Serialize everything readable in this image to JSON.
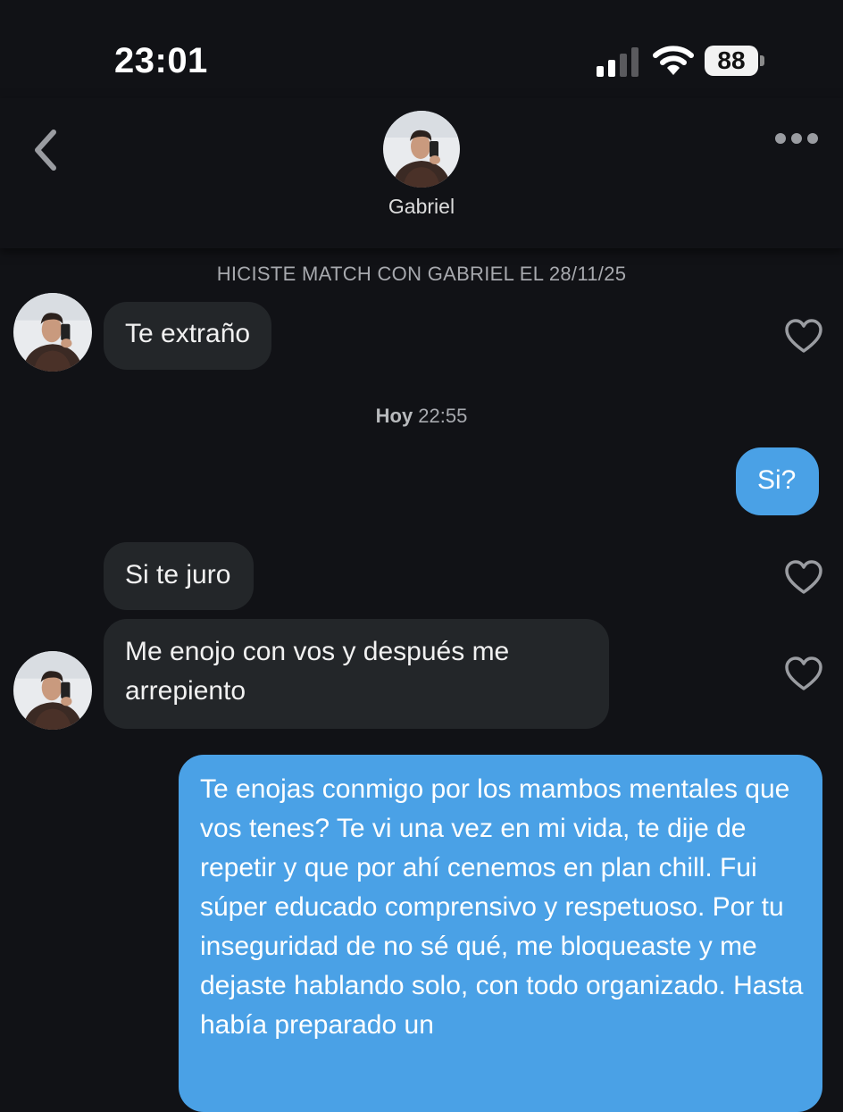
{
  "status_bar": {
    "time": "23:01",
    "battery_level": "88",
    "signal_icon": "cell-signal-icon",
    "wifi_icon": "wifi-icon"
  },
  "header": {
    "contact_name": "Gabriel",
    "back_icon": "chevron-left-icon",
    "more_icon": "ellipsis-icon"
  },
  "chat": {
    "match_notice": "HICISTE MATCH CON GABRIEL EL 28/11/25",
    "timestamp_day": "Hoy",
    "timestamp_time": " 22:55",
    "messages": [
      {
        "direction": "incoming",
        "text": "Te extraño"
      },
      {
        "direction": "outgoing",
        "text": "Si?"
      },
      {
        "direction": "incoming",
        "text": "Si te juro"
      },
      {
        "direction": "incoming",
        "text": "Me enojo con vos y después me arrepiento"
      },
      {
        "direction": "outgoing",
        "text": "Te enojas conmigo por los mambos mentales que vos tenes? Te vi una vez en mi vida, te dije de repetir y que por ahí cenemos en plan chill. Fui súper educado comprensivo y respetuoso. Por tu inseguridad de no sé qué, me bloqueaste y me dejaste hablando solo, con todo organizado. Hasta había preparado un"
      }
    ]
  },
  "colors": {
    "background": "#111216",
    "incoming_bubble": "#232629",
    "outgoing_bubble": "#4aa1e6"
  }
}
